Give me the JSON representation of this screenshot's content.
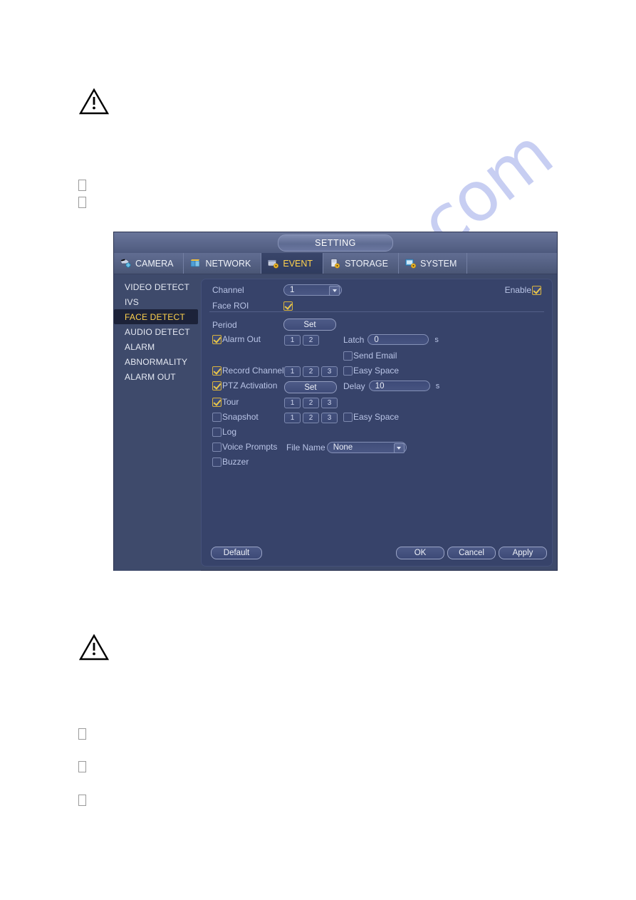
{
  "watermark": "manualslib.com",
  "document": {
    "warning_icon_name": "warning-triangle-icon",
    "bullet_glyph": ""
  },
  "window": {
    "title": "SETTING",
    "tabs": [
      {
        "label": "CAMERA",
        "icon": "camera-icon",
        "active": false
      },
      {
        "label": "NETWORK",
        "icon": "network-icon",
        "active": false
      },
      {
        "label": "EVENT",
        "icon": "event-icon",
        "active": true
      },
      {
        "label": "STORAGE",
        "icon": "storage-icon",
        "active": false
      },
      {
        "label": "SYSTEM",
        "icon": "system-icon",
        "active": false
      }
    ],
    "sidebar": {
      "items": [
        {
          "label": "VIDEO DETECT",
          "active": false
        },
        {
          "label": "IVS",
          "active": false
        },
        {
          "label": "FACE DETECT",
          "active": true
        },
        {
          "label": "AUDIO DETECT",
          "active": false
        },
        {
          "label": "ALARM",
          "active": false
        },
        {
          "label": "ABNORMALITY",
          "active": false
        },
        {
          "label": "ALARM OUT",
          "active": false
        }
      ]
    },
    "form": {
      "channel_label": "Channel",
      "channel_value": "1",
      "enable_label": "Enable",
      "enable_checked": true,
      "face_roi_label": "Face ROI",
      "face_roi_checked": true,
      "period_label": "Period",
      "period_button": "Set",
      "alarm_out_label": "Alarm Out",
      "alarm_out_checked": true,
      "alarm_out_chips": [
        "1",
        "2"
      ],
      "latch_label": "Latch",
      "latch_value": "0",
      "latch_unit": "s",
      "send_email_label": "Send Email",
      "send_email_checked": false,
      "record_channel_label": "Record Channel",
      "record_channel_checked": true,
      "record_channel_chips": [
        "1",
        "2",
        "3"
      ],
      "record_easy_space_label": "Easy Space",
      "record_easy_space_checked": false,
      "ptz_activation_label": "PTZ Activation",
      "ptz_activation_checked": true,
      "ptz_button": "Set",
      "delay_label": "Delay",
      "delay_value": "10",
      "delay_unit": "s",
      "tour_label": "Tour",
      "tour_checked": true,
      "tour_chips": [
        "1",
        "2",
        "3"
      ],
      "snapshot_label": "Snapshot",
      "snapshot_checked": false,
      "snapshot_chips": [
        "1",
        "2",
        "3"
      ],
      "snapshot_easy_space_label": "Easy Space",
      "snapshot_easy_space_checked": false,
      "log_label": "Log",
      "log_checked": false,
      "voice_prompts_label": "Voice Prompts",
      "voice_prompts_checked": false,
      "file_name_label": "File Name",
      "file_name_value": "None",
      "buzzer_label": "Buzzer",
      "buzzer_checked": false
    },
    "footer": {
      "default_label": "Default",
      "ok_label": "OK",
      "cancel_label": "Cancel",
      "apply_label": "Apply"
    },
    "colors": {
      "window_bg": "#3e4a6b",
      "panel_bg": "#37436a",
      "accent_active": "#ffd24d",
      "label_text": "#b9c4e6",
      "checkbox_on": "#e7c64a"
    }
  }
}
